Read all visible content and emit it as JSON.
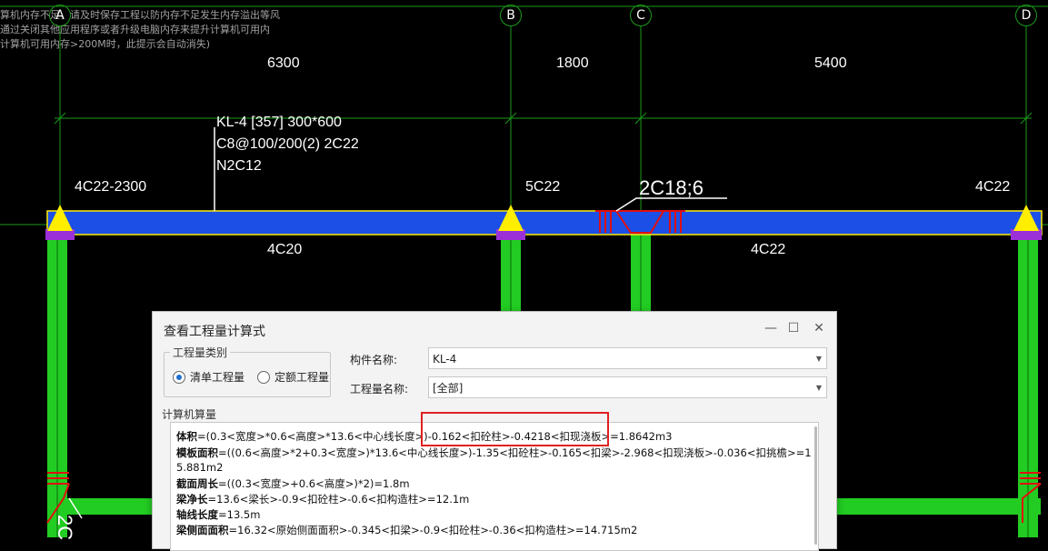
{
  "warning": {
    "lines": [
      "算机内存不足，请及时保存工程以防内存不足发生内存溢出等风",
      "通过关闭其他应用程序或者升级电脑内存来提升计算机可用内",
      "计算机可用内存>200M时，此提示会自动消失)"
    ]
  },
  "axes": [
    "A",
    "B",
    "C",
    "D"
  ],
  "dimensions": [
    "6300",
    "1800",
    "5400"
  ],
  "beam_label": {
    "line1": "KL-4 [357] 300*600",
    "line2": "C8@100/200(2) 2C22",
    "line3": "N2C12"
  },
  "rebar_labels": {
    "top_left": "4C22-2300",
    "top_b": "5C22",
    "top_c": "2C18;6",
    "top_d": "4C22",
    "bottom_left": "4C20",
    "bottom_right": "4C22",
    "side_left": "2C"
  },
  "colors": {
    "beam_blue": "#1c4fe6",
    "column_green": "#22cc22",
    "support_yellow": "#ffee00",
    "support_purple": "#9b30d9",
    "rebar_red": "#e01010",
    "axis_green": "#1a9a1a",
    "highlight_red": "#e02020"
  },
  "dialog": {
    "title": "查看工程量计算式",
    "minimize": "—",
    "maximize": "☐",
    "close": "✕",
    "category_legend": "工程量类别",
    "radio_list": "清单工程量",
    "radio_quota": "定额工程量",
    "component_label": "构件名称:",
    "component_value": "KL-4",
    "quantity_label": "工程量名称:",
    "quantity_value": "[全部]",
    "calc_legend": "计算机算量",
    "calc_lines": [
      {
        "key": "体积",
        "text": "=(0.3<宽度>*0.6<高度>*13.6<中心线长度>)-0.162<扣砼柱>-0.4218<扣现浇板>=1.8642m3"
      },
      {
        "key": "模板面积",
        "text": "=((0.6<高度>*2+0.3<宽度>)*13.6<中心线长度>)-1.35<扣砼柱>-0.165<扣梁>-2.968<扣现浇板>-0.036<扣挑檐>=1"
      },
      {
        "key": "",
        "text": "5.881m2"
      },
      {
        "key": "截面周长",
        "text": "=((0.3<宽度>+0.6<高度>)*2)=1.8m"
      },
      {
        "key": "梁净长",
        "text": "=13.6<梁长>-0.9<扣砼柱>-0.6<扣构造柱>=12.1m"
      },
      {
        "key": "轴线长度",
        "text": "=13.5m"
      },
      {
        "key": "梁侧面面积",
        "text": "=16.32<原始侧面面积>-0.345<扣梁>-0.9<扣砼柱>-0.36<扣构造柱>=14.715m2"
      }
    ]
  }
}
